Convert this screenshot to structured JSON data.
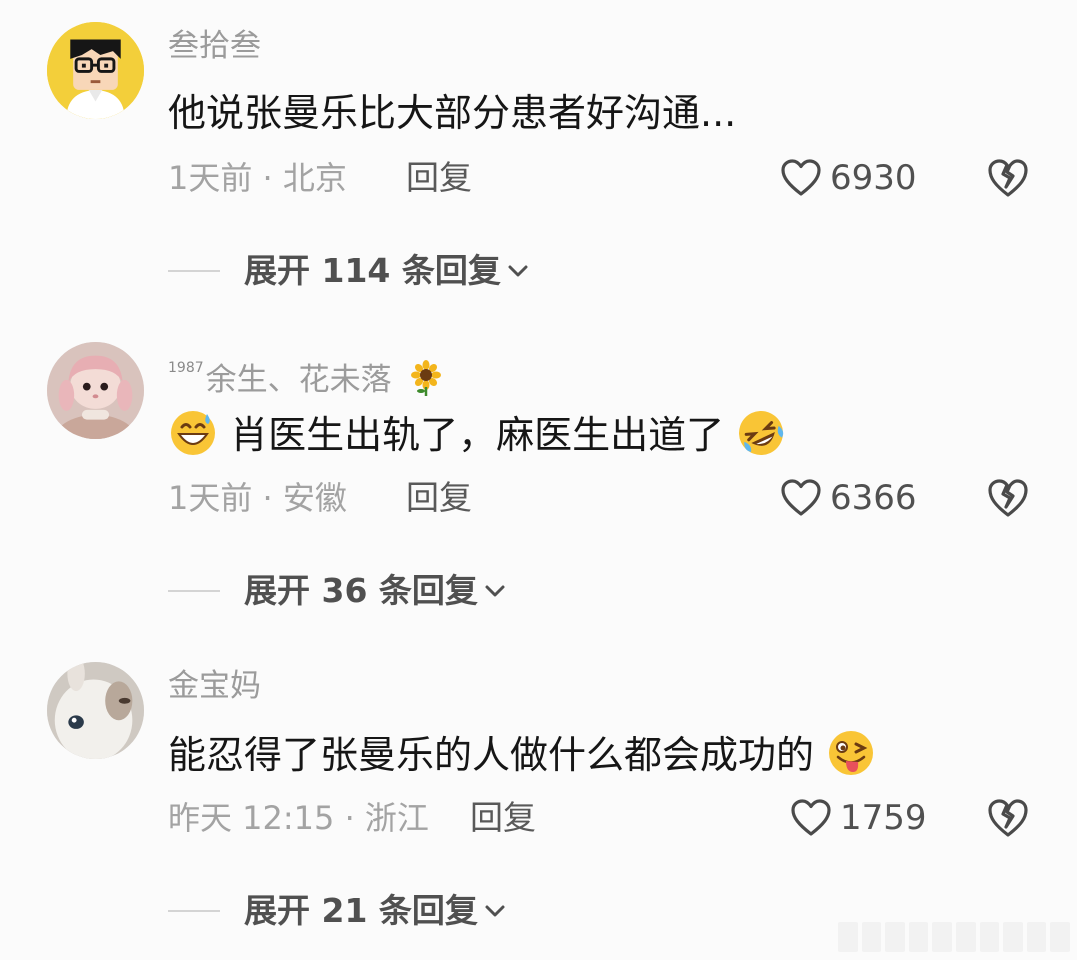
{
  "comments": [
    {
      "username": "叁拾叁",
      "badge": "",
      "text": "他说张曼乐比大部分患者好沟通...",
      "time_location": "1天前 · 北京",
      "reply_label": "回复",
      "likes": "6930",
      "expand_label": "展开 114 条回复"
    },
    {
      "username": "余生、花未落",
      "badge": "1987",
      "text": "肖医生出轨了，麻医生出道了",
      "time_location": "1天前 · 安徽",
      "reply_label": "回复",
      "likes": "6366",
      "expand_label": "展开 36 条回复"
    },
    {
      "username": "金宝妈",
      "badge": "",
      "text": "能忍得了张曼乐的人做什么都会成功的",
      "time_location": "昨天 12:15 · 浙江",
      "reply_label": "回复",
      "likes": "1759",
      "expand_label": "展开 21 条回复"
    }
  ],
  "icons": {
    "like": "heart-outline-icon",
    "dislike": "broken-heart-icon",
    "expand": "chevron-down-icon",
    "emoji_1": "grinning-sweat-emoji",
    "emoji_2": "rolling-laughing-emoji",
    "emoji_3": "winking-tongue-emoji",
    "username_icon": "sunflower-icon"
  },
  "colors": {
    "background": "#fbfbfb",
    "username": "#9b9b9b",
    "text": "#161616",
    "meta": "#a3a3a3",
    "action": "#505050"
  }
}
